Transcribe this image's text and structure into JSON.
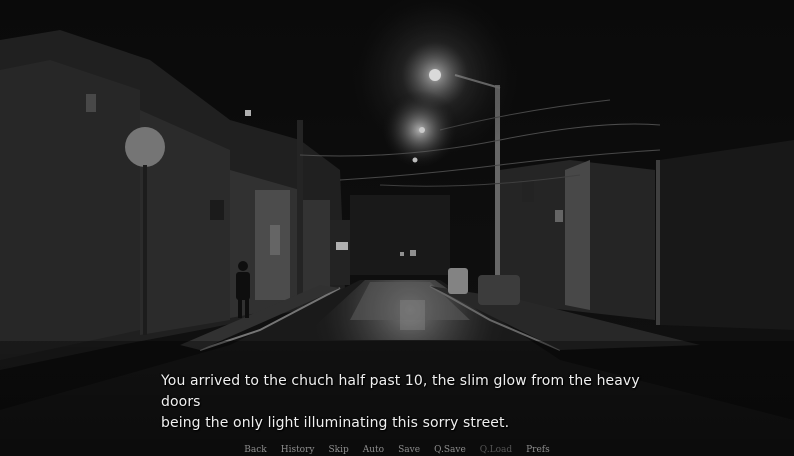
{
  "dialogue": {
    "line1": "You arrived to the chuch half past 10, the slim glow from the heavy doors",
    "line2": "being the only light illuminating this sorry street."
  },
  "quick_menu": [
    {
      "label": "Back",
      "enabled": true
    },
    {
      "label": "History",
      "enabled": true
    },
    {
      "label": "Skip",
      "enabled": true
    },
    {
      "label": "Auto",
      "enabled": true
    },
    {
      "label": "Save",
      "enabled": true
    },
    {
      "label": "Q.Save",
      "enabled": true
    },
    {
      "label": "Q.Load",
      "enabled": false
    },
    {
      "label": "Prefs",
      "enabled": true
    }
  ],
  "colors": {
    "dialogue_text": "#f0f0f0",
    "menu_text": "#8d8d8d",
    "menu_text_disabled": "#555555"
  }
}
